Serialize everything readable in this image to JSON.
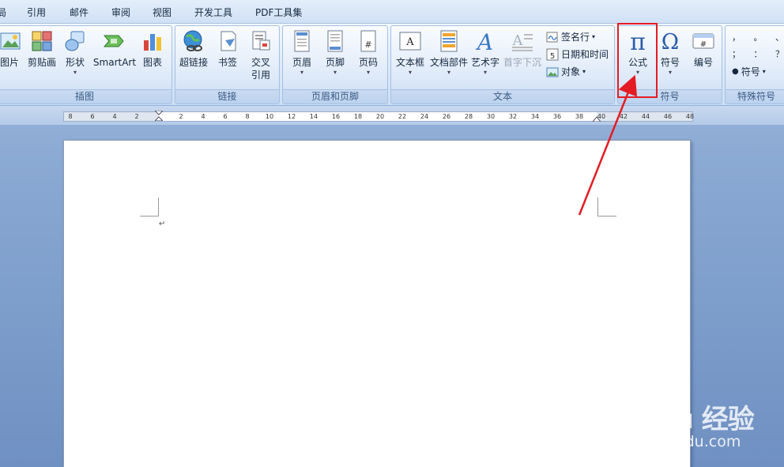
{
  "tabs": [
    {
      "label": "局"
    },
    {
      "label": "引用"
    },
    {
      "label": "邮件"
    },
    {
      "label": "审阅"
    },
    {
      "label": "视图"
    },
    {
      "label": "开发工具"
    },
    {
      "label": "PDF工具集"
    }
  ],
  "ribbon": {
    "illustrations": {
      "group_label": "插图",
      "picture": "图片",
      "clipart": "剪贴画",
      "shapes": "形状",
      "smartart": "SmartArt",
      "chart": "图表"
    },
    "links": {
      "group_label": "链接",
      "hyperlink": "超链接",
      "bookmark": "书签",
      "crossref_line1": "交叉",
      "crossref_line2": "引用"
    },
    "header_footer": {
      "group_label": "页眉和页脚",
      "header": "页眉",
      "footer": "页脚",
      "page_number": "页码"
    },
    "text": {
      "group_label": "文本",
      "textbox": "文本框",
      "quickparts": "文档部件",
      "wordart": "艺术字",
      "dropcap": "首字下沉",
      "signature_line": "签名行",
      "date_time": "日期和时间",
      "object": "对象"
    },
    "symbols": {
      "group_label": "符号",
      "equation": "公式",
      "symbol": "符号",
      "number": "编号"
    },
    "special_symbols": {
      "group_label": "特殊符号",
      "symbol": "符号",
      "marks_row1": [
        "，",
        "。",
        "、"
      ],
      "marks_row2": [
        "；",
        "：",
        "？"
      ]
    }
  },
  "ruler": {
    "labels": [
      "8",
      "6",
      "4",
      "2",
      "2",
      "4",
      "6",
      "8",
      "10",
      "12",
      "14",
      "16",
      "18",
      "20",
      "22",
      "24",
      "26",
      "28",
      "30",
      "32",
      "34",
      "36",
      "38",
      "40",
      "42",
      "44",
      "46",
      "48"
    ]
  },
  "document": {
    "paragraph_mark": "↵"
  },
  "watermark": {
    "logo_text": "Bai du 经验",
    "subtitle": "jingyan.baidu.com"
  },
  "annotation": {
    "color": "#e41b23"
  }
}
